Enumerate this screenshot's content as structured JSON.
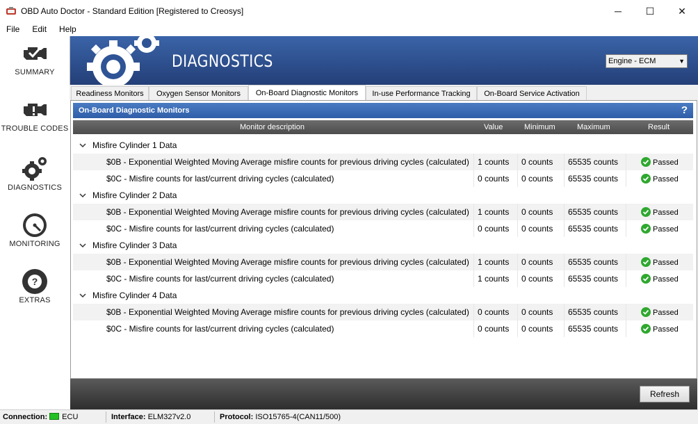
{
  "window": {
    "title": "OBD Auto Doctor - Standard Edition [Registered to Creosys]",
    "controls": {
      "minimize": "─",
      "maximize": "☐",
      "close": "✕"
    }
  },
  "menu": [
    "File",
    "Edit",
    "Help"
  ],
  "nav": [
    {
      "label": "SUMMARY",
      "icon": "engine-check-icon"
    },
    {
      "label": "TROUBLE CODES",
      "icon": "engine-warning-icon"
    },
    {
      "label": "DIAGNOSTICS",
      "icon": "gears-icon"
    },
    {
      "label": "MONITORING",
      "icon": "gauge-icon"
    },
    {
      "label": "EXTRAS",
      "icon": "lifebuoy-icon"
    }
  ],
  "header": {
    "title": "DIAGNOSTICS",
    "ecu_select": "Engine - ECM"
  },
  "tabs": [
    {
      "label": "Readiness Monitors",
      "active": false
    },
    {
      "label": "Oxygen Sensor Monitors",
      "active": false
    },
    {
      "label": "On-Board Diagnostic Monitors",
      "active": true
    },
    {
      "label": "In-use Performance Tracking",
      "active": false
    },
    {
      "label": "On-Board Service Activation",
      "active": false
    }
  ],
  "panel": {
    "title": "On-Board Diagnostic Monitors",
    "help": "?",
    "columns": {
      "description": "Monitor description",
      "value": "Value",
      "minimum": "Minimum",
      "maximum": "Maximum",
      "result": "Result"
    },
    "groups": [
      {
        "name": "Misfire Cylinder 1 Data",
        "rows": [
          {
            "desc": "$0B - Exponential Weighted Moving Average misfire counts for previous driving cycles (calculated)",
            "value": "1 counts",
            "min": "0 counts",
            "max": "65535 counts",
            "result": "Passed"
          },
          {
            "desc": "$0C - Misfire counts for last/current driving cycles (calculated)",
            "value": "0 counts",
            "min": "0 counts",
            "max": "65535 counts",
            "result": "Passed"
          }
        ]
      },
      {
        "name": "Misfire Cylinder 2 Data",
        "rows": [
          {
            "desc": "$0B - Exponential Weighted Moving Average misfire counts for previous driving cycles (calculated)",
            "value": "1 counts",
            "min": "0 counts",
            "max": "65535 counts",
            "result": "Passed"
          },
          {
            "desc": "$0C - Misfire counts for last/current driving cycles (calculated)",
            "value": "0 counts",
            "min": "0 counts",
            "max": "65535 counts",
            "result": "Passed"
          }
        ]
      },
      {
        "name": "Misfire Cylinder 3 Data",
        "rows": [
          {
            "desc": "$0B - Exponential Weighted Moving Average misfire counts for previous driving cycles (calculated)",
            "value": "1 counts",
            "min": "0 counts",
            "max": "65535 counts",
            "result": "Passed"
          },
          {
            "desc": "$0C - Misfire counts for last/current driving cycles (calculated)",
            "value": "1 counts",
            "min": "0 counts",
            "max": "65535 counts",
            "result": "Passed"
          }
        ]
      },
      {
        "name": "Misfire Cylinder 4 Data",
        "rows": [
          {
            "desc": "$0B - Exponential Weighted Moving Average misfire counts for previous driving cycles (calculated)",
            "value": "0 counts",
            "min": "0 counts",
            "max": "65535 counts",
            "result": "Passed"
          },
          {
            "desc": "$0C - Misfire counts for last/current driving cycles (calculated)",
            "value": "0 counts",
            "min": "0 counts",
            "max": "65535 counts",
            "result": "Passed"
          }
        ]
      }
    ]
  },
  "actions": {
    "refresh": "Refresh"
  },
  "status": {
    "connection_label": "Connection:",
    "connection_value": "ECU",
    "interface_label": "Interface:",
    "interface_value": "ELM327v2.0",
    "protocol_label": "Protocol:",
    "protocol_value": "ISO15765-4(CAN11/500)"
  },
  "colors": {
    "banner": "#2f5496",
    "panel_header": "#3a6db5",
    "passed": "#2fa82f",
    "connection_led": "#22c022"
  }
}
